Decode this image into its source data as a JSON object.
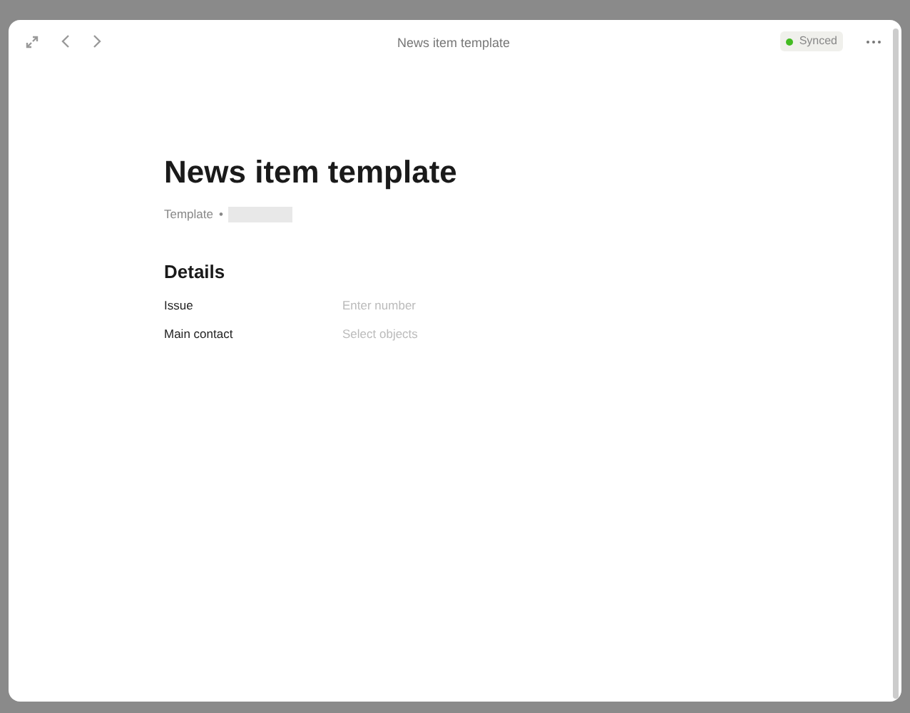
{
  "window": {
    "title": "News item template"
  },
  "sync_status": {
    "label": "Synced",
    "color": "#44bb22"
  },
  "page": {
    "title": "News item template",
    "template_label": "Template",
    "template_separator": "•"
  },
  "section": {
    "title": "Details",
    "fields": [
      {
        "label": "Issue",
        "placeholder": "Enter number"
      },
      {
        "label": "Main contact",
        "placeholder": "Select objects"
      }
    ]
  }
}
